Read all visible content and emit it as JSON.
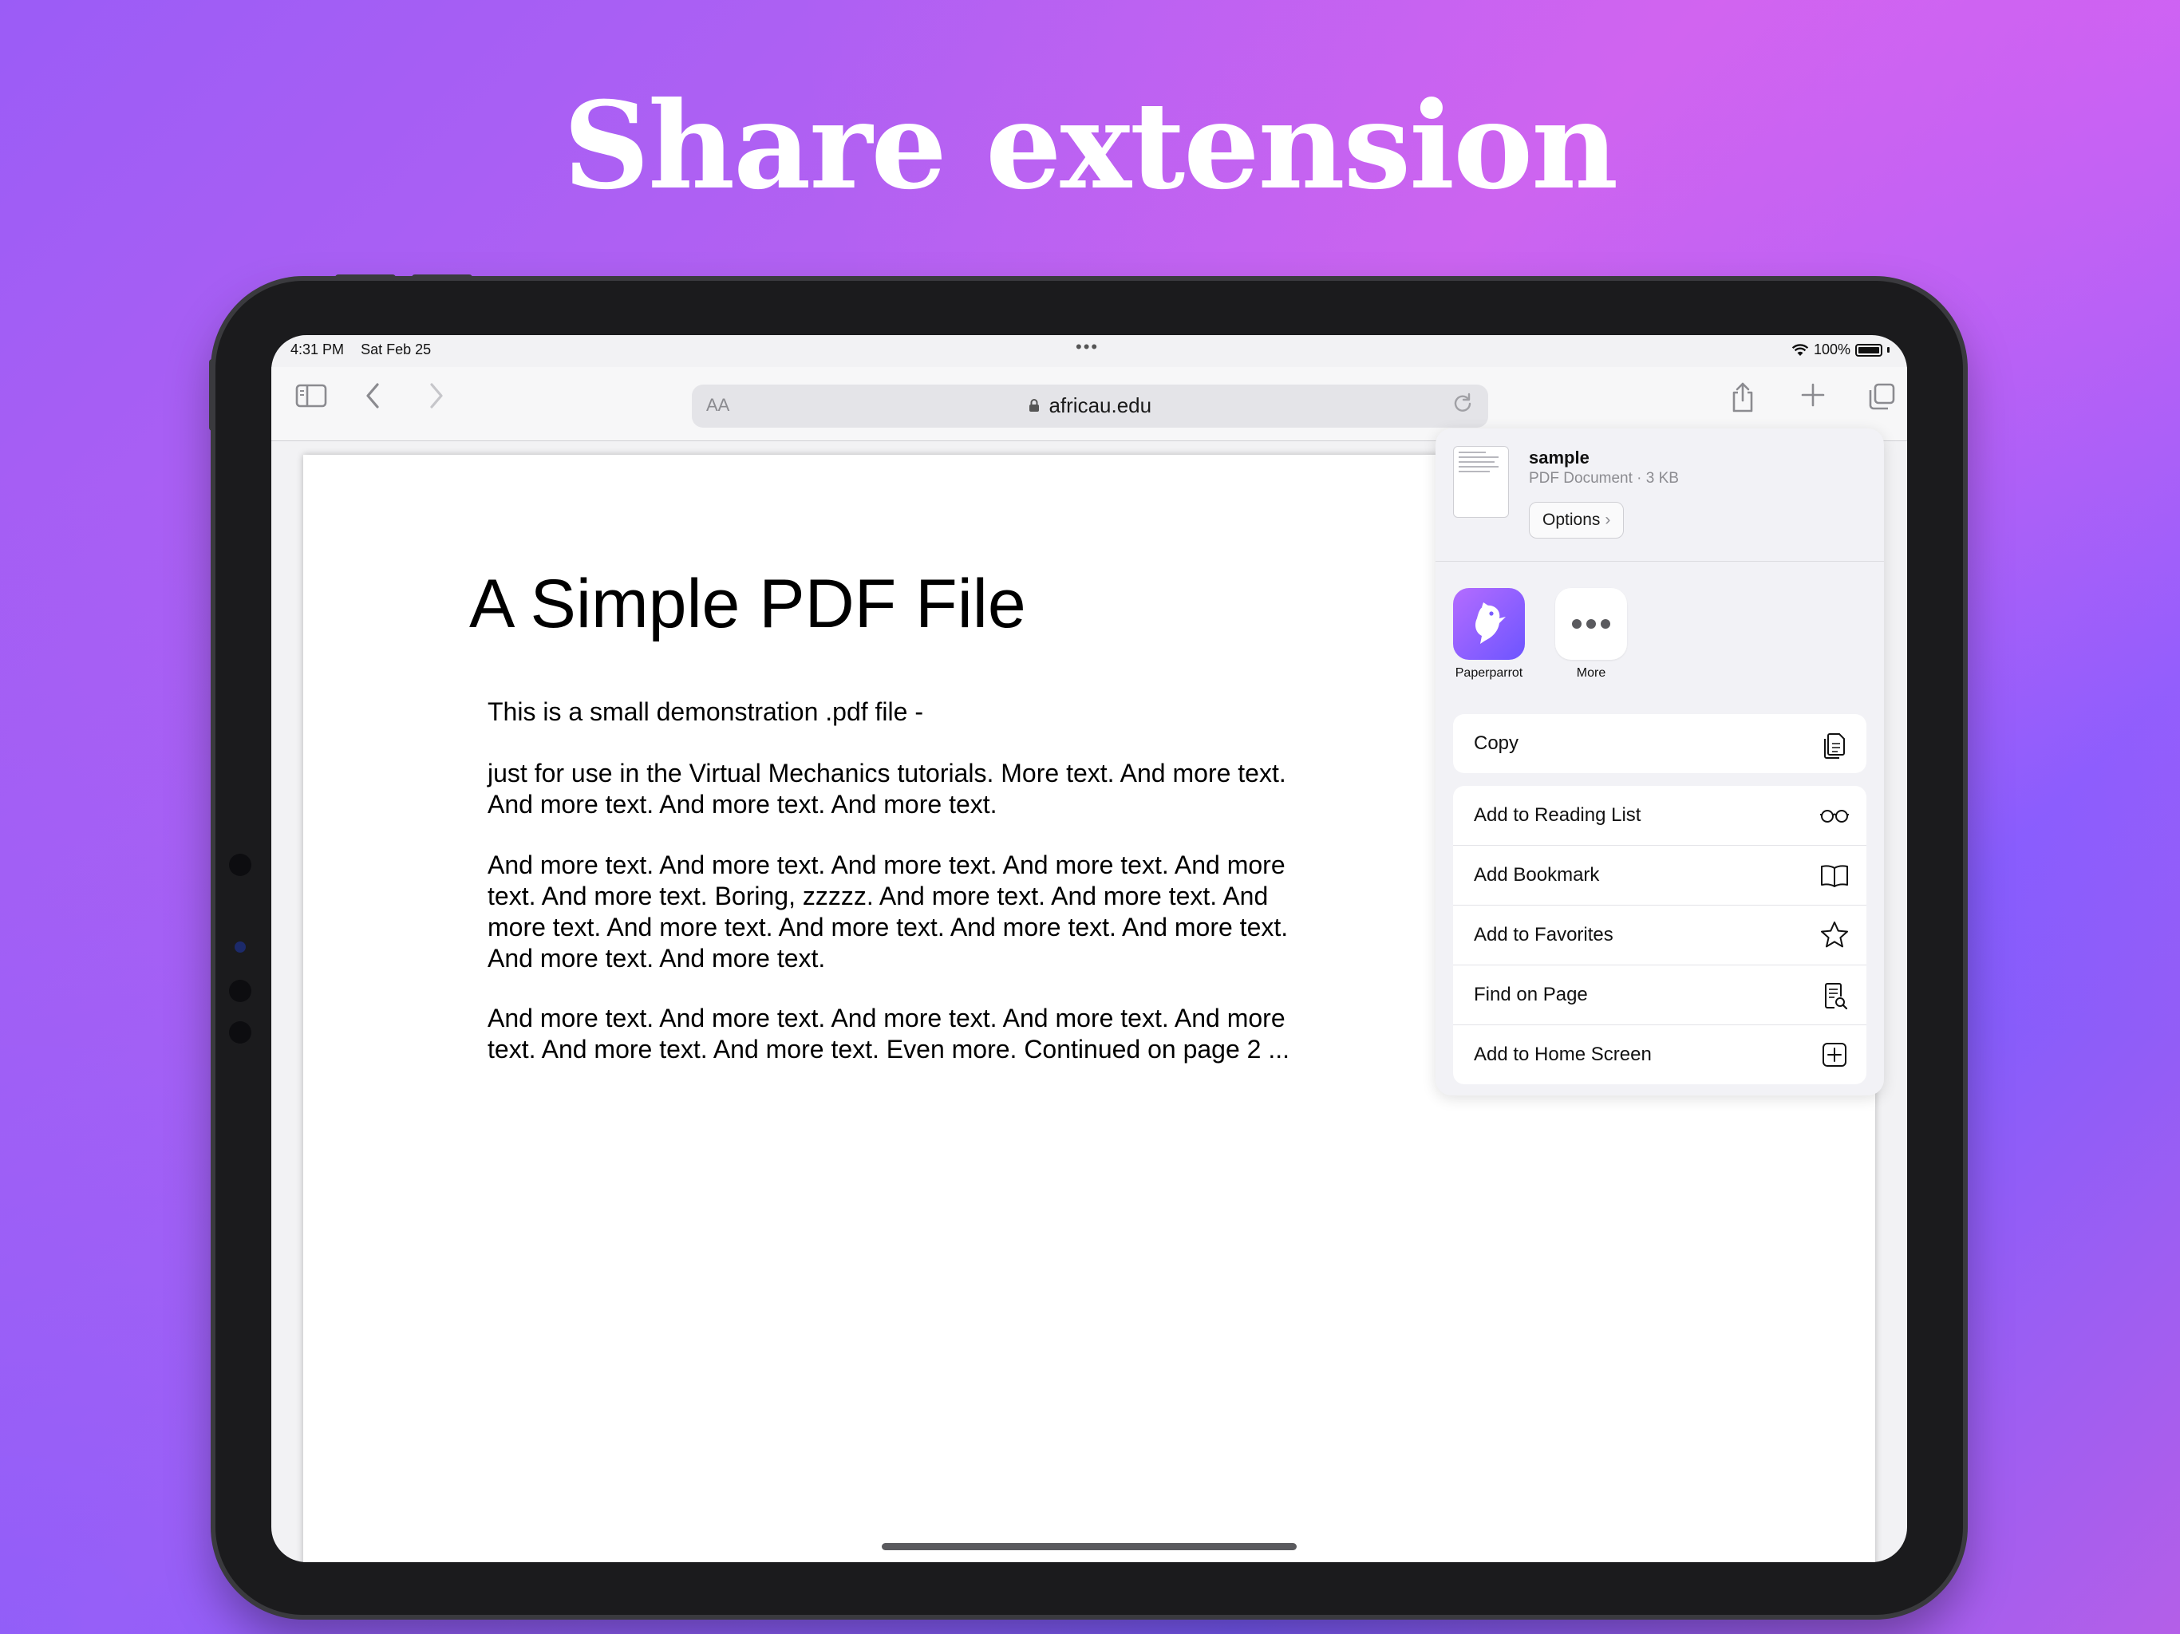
{
  "headline": "Share extension",
  "status_bar": {
    "time": "4:31 PM",
    "date": "Sat Feb 25",
    "battery": "100%"
  },
  "browser": {
    "url": "africau.edu",
    "text_size_label": "AA"
  },
  "pdf": {
    "title": "A Simple PDF File",
    "paragraphs": [
      "This is a small demonstration .pdf file -",
      "just for use in the Virtual Mechanics tutorials. More text. And more text. And more text. And more text. And more text.",
      "And more text. And more text. And more text. And more text. And more text. And more text. Boring, zzzzz. And more text. And more text. And more text. And more text. And more text. And more text. And more text. And more text. And more text.",
      "And more text. And more text. And more text. And more text. And more text. And more text. And more text. Even more. Continued on page 2 ..."
    ]
  },
  "share_sheet": {
    "doc_name": "sample",
    "doc_meta": "PDF Document · 3 KB",
    "options_label": "Options",
    "apps": [
      {
        "label": "Paperparrot",
        "icon": "paperparrot-app-icon"
      },
      {
        "label": "More",
        "icon": "more-dots-icon"
      }
    ],
    "copy_label": "Copy",
    "actions": [
      {
        "label": "Add to Reading List",
        "icon": "glasses-icon"
      },
      {
        "label": "Add Bookmark",
        "icon": "book-icon"
      },
      {
        "label": "Add to Favorites",
        "icon": "star-icon"
      },
      {
        "label": "Find on Page",
        "icon": "find-doc-icon"
      },
      {
        "label": "Add to Home Screen",
        "icon": "plus-square-icon"
      }
    ]
  }
}
